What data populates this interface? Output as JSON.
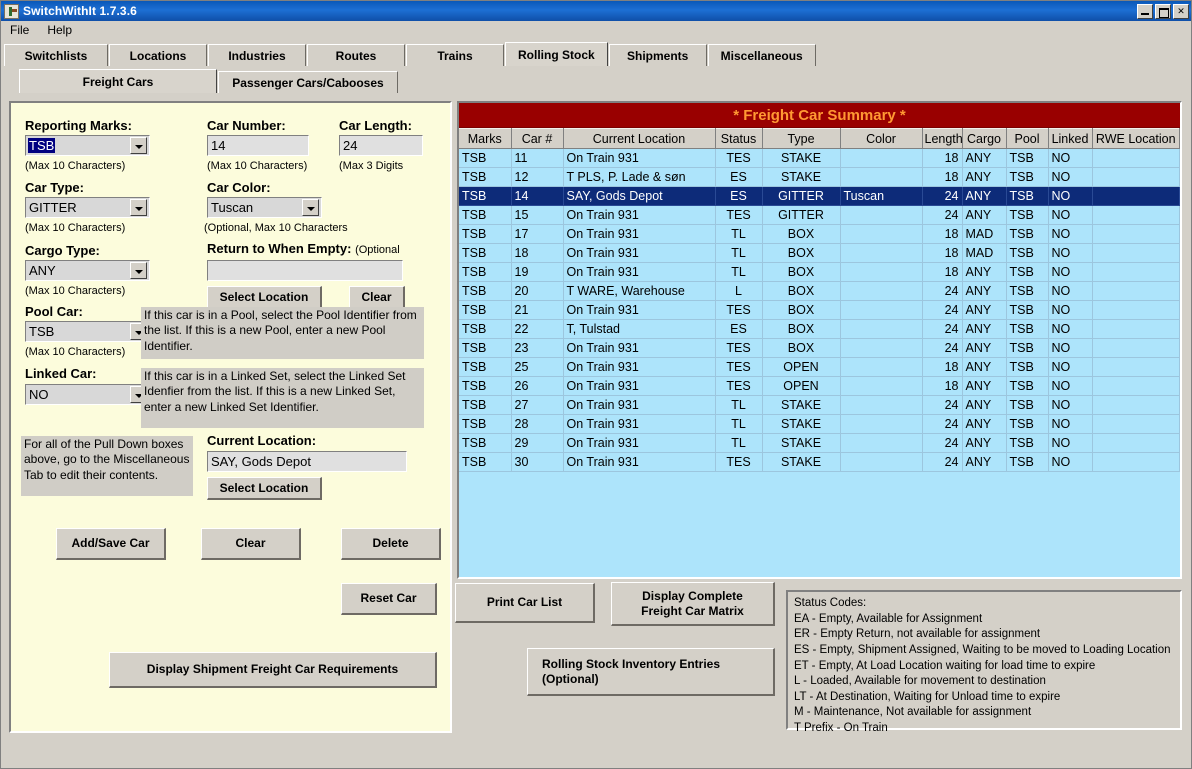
{
  "window": {
    "title": "SwitchWithIt 1.7.3.6",
    "icon": "app-icon",
    "buttons": {
      "minimize": "_",
      "maximize": "□",
      "close": "✕"
    }
  },
  "menu": {
    "items": [
      "File",
      "Help"
    ]
  },
  "tabs_main": {
    "items": [
      "Switchlists",
      "Locations",
      "Industries",
      "Routes",
      "Trains",
      "Rolling Stock",
      "Shipments",
      "Miscellaneous"
    ],
    "selected": "Rolling Stock"
  },
  "tabs_sub": {
    "items": [
      "Freight Cars",
      "Passenger Cars/Cabooses"
    ],
    "selected": "Freight Cars"
  },
  "form": {
    "reporting_marks": {
      "label": "Reporting Marks:",
      "value": "TSB",
      "hint": "(Max 10 Characters)"
    },
    "car_number": {
      "label": "Car Number:",
      "value": "14",
      "hint": "(Max 10 Characters)"
    },
    "car_length": {
      "label": "Car Length:",
      "value": "24",
      "hint": "(Max 3 Digits"
    },
    "car_type": {
      "label": "Car Type:",
      "value": "GITTER",
      "hint": "(Max 10 Characters)"
    },
    "car_color": {
      "label": "Car Color:",
      "value": "Tuscan",
      "hint": "(Optional, Max 10 Characters"
    },
    "cargo_type": {
      "label": "Cargo Type:",
      "value": "ANY",
      "hint": "(Max 10 Characters)"
    },
    "return_when_empty": {
      "label": "Return to When Empty:",
      "optional": "(Optional",
      "value": ""
    },
    "rwe_select_location": "Select Location",
    "rwe_clear": "Clear",
    "pool_car": {
      "label": "Pool Car:",
      "value": "TSB",
      "hint": "(Max 10 Characters)"
    },
    "pool_note": "If this car is in a Pool, select the Pool Identifier from the list.  If this is a new Pool, enter a new Pool Identifier.",
    "linked_car": {
      "label": "Linked Car:",
      "value": "NO"
    },
    "linked_note": "If this car is in a Linked Set, select the Linked Set Idenfier from the list.  If this is a new Linked Set, enter a new Linked Set Identifier.",
    "pulldown_note": "For all of the Pull Down boxes above, go to the Miscellaneous Tab to edit their contents.",
    "current_location": {
      "label": "Current Location:",
      "value": "SAY, Gods Depot"
    },
    "cl_select_location": "Select Location",
    "add_save": "Add/Save Car",
    "clear": "Clear",
    "delete": "Delete"
  },
  "actions": {
    "reset_car": "Reset Car",
    "print_car_list": "Print Car List",
    "display_matrix_l1": "Display Complete",
    "display_matrix_l2": "Freight Car Matrix",
    "display_shipment_req": "Display Shipment Freight Car Requirements",
    "rolling_stock_l1": "Rolling Stock Inventory Entries",
    "rolling_stock_l2": "(Optional)"
  },
  "table": {
    "title": "* Freight Car Summary *",
    "columns": [
      "Marks",
      "Car #",
      "Current Location",
      "Status",
      "Type",
      "Color",
      "Length",
      "Cargo",
      "Pool",
      "Linked",
      "RWE Location"
    ],
    "selected_index": 2,
    "rows": [
      [
        "TSB",
        "11",
        "On Train 931",
        "TES",
        "STAKE",
        "",
        "18",
        "ANY",
        "TSB",
        "NO",
        ""
      ],
      [
        "TSB",
        "12",
        "T PLS, P. Lade & søn",
        "ES",
        "STAKE",
        "",
        "18",
        "ANY",
        "TSB",
        "NO",
        ""
      ],
      [
        "TSB",
        "14",
        "SAY, Gods Depot",
        "ES",
        "GITTER",
        "Tuscan",
        "24",
        "ANY",
        "TSB",
        "NO",
        ""
      ],
      [
        "TSB",
        "15",
        "On Train 931",
        "TES",
        "GITTER",
        "",
        "24",
        "ANY",
        "TSB",
        "NO",
        ""
      ],
      [
        "TSB",
        "17",
        "On Train 931",
        "TL",
        "BOX",
        "",
        "18",
        "MAD",
        "TSB",
        "NO",
        ""
      ],
      [
        "TSB",
        "18",
        "On Train 931",
        "TL",
        "BOX",
        "",
        "18",
        "MAD",
        "TSB",
        "NO",
        ""
      ],
      [
        "TSB",
        "19",
        "On Train 931",
        "TL",
        "BOX",
        "",
        "18",
        "ANY",
        "TSB",
        "NO",
        ""
      ],
      [
        "TSB",
        "20",
        "T WARE, Warehouse",
        "L",
        "BOX",
        "",
        "24",
        "ANY",
        "TSB",
        "NO",
        ""
      ],
      [
        "TSB",
        "21",
        "On Train 931",
        "TES",
        "BOX",
        "",
        "24",
        "ANY",
        "TSB",
        "NO",
        ""
      ],
      [
        "TSB",
        "22",
        "T, Tulstad",
        "ES",
        "BOX",
        "",
        "24",
        "ANY",
        "TSB",
        "NO",
        ""
      ],
      [
        "TSB",
        "23",
        "On Train 931",
        "TES",
        "BOX",
        "",
        "24",
        "ANY",
        "TSB",
        "NO",
        ""
      ],
      [
        "TSB",
        "25",
        "On Train 931",
        "TES",
        "OPEN",
        "",
        "18",
        "ANY",
        "TSB",
        "NO",
        ""
      ],
      [
        "TSB",
        "26",
        "On Train 931",
        "TES",
        "OPEN",
        "",
        "18",
        "ANY",
        "TSB",
        "NO",
        ""
      ],
      [
        "TSB",
        "27",
        "On Train 931",
        "TL",
        "STAKE",
        "",
        "24",
        "ANY",
        "TSB",
        "NO",
        ""
      ],
      [
        "TSB",
        "28",
        "On Train 931",
        "TL",
        "STAKE",
        "",
        "24",
        "ANY",
        "TSB",
        "NO",
        ""
      ],
      [
        "TSB",
        "29",
        "On Train 931",
        "TL",
        "STAKE",
        "",
        "24",
        "ANY",
        "TSB",
        "NO",
        ""
      ],
      [
        "TSB",
        "30",
        "On Train 931",
        "TES",
        "STAKE",
        "",
        "24",
        "ANY",
        "TSB",
        "NO",
        ""
      ]
    ]
  },
  "status_codes": {
    "heading": "Status Codes:",
    "lines": [
      "EA - Empty, Available for Assignment",
      "ER - Empty Return, not available for assignment",
      "ES - Empty, Shipment Assigned, Waiting to be moved to Loading Location",
      "ET - Empty, At Load Location waiting for load time to expire",
      "L - Loaded, Available for movement to destination",
      "LT - At Destination, Waiting for Unload time to expire",
      "M - Maintenance, Not available for assignment",
      "T Prefix - On Train"
    ]
  },
  "colors": {
    "title_bar": "#0f4fa8",
    "panel_bg": "#fcfcdc",
    "table_header_bg": "#990000",
    "table_header_text": "#ff9933",
    "grid_bg": "#ade4fb",
    "row_selected": "#0d2b79",
    "face": "#d4d0c8"
  }
}
